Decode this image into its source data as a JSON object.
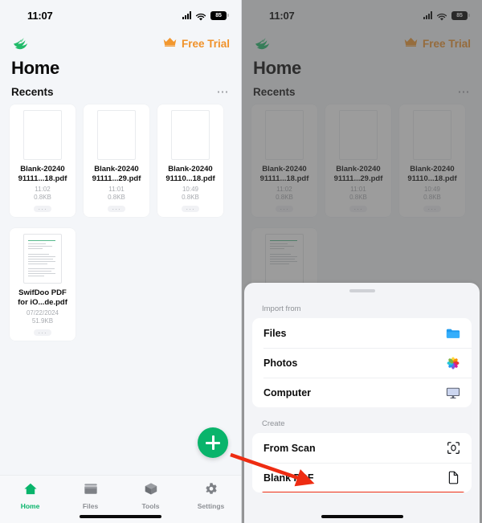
{
  "status_bar": {
    "time": "11:07",
    "signal_icon": "cellular-bars-icon",
    "wifi_icon": "wifi-icon",
    "battery_level": "85"
  },
  "header": {
    "logo_icon": "swifdoo-bird-logo",
    "crown_icon": "crown-icon",
    "trial_label": "Free Trial",
    "page_title": "Home"
  },
  "recents": {
    "section_title": "Recents",
    "more_icon": "ellipsis-icon",
    "items": [
      {
        "name": "Blank-2024091111...18.pdf",
        "name_line1": "Blank-20240",
        "name_line2": "91111...18.pdf",
        "time": "11:02",
        "size": "0.8KB",
        "more": "···"
      },
      {
        "name": "Blank-2024091111...29.pdf",
        "name_line1": "Blank-20240",
        "name_line2": "91111...29.pdf",
        "time": "11:01",
        "size": "0.8KB",
        "more": "···"
      },
      {
        "name": "Blank-2024091110...18.pdf",
        "name_line1": "Blank-20240",
        "name_line2": "91110...18.pdf",
        "time": "10:49",
        "size": "0.8KB",
        "more": "···"
      },
      {
        "name": "SwifDoo PDF for iO...de.pdf",
        "name_line1": "SwifDoo PDF",
        "name_line2": "for iO...de.pdf",
        "time": "07/22/2024",
        "size": "51.9KB",
        "more": "···"
      }
    ]
  },
  "fab": {
    "icon": "plus-icon",
    "label": ""
  },
  "tabbar": {
    "items": [
      {
        "label": "Home",
        "icon": "home-icon",
        "active": true
      },
      {
        "label": "Files",
        "icon": "folder-icon",
        "active": false
      },
      {
        "label": "Tools",
        "icon": "cube-icon",
        "active": false
      },
      {
        "label": "Settings",
        "icon": "gear-icon",
        "active": false
      }
    ]
  },
  "sheet": {
    "grabber_icon": "drag-handle-icon",
    "import_label": "Import from",
    "import_items": [
      {
        "label": "Files",
        "icon": "blue-folder-icon"
      },
      {
        "label": "Photos",
        "icon": "photos-flower-icon"
      },
      {
        "label": "Computer",
        "icon": "monitor-icon"
      }
    ],
    "create_label": "Create",
    "create_items": [
      {
        "label": "From Scan",
        "icon": "scan-icon"
      },
      {
        "label": "Blank PDF",
        "icon": "blank-document-icon"
      }
    ]
  },
  "annotation": {
    "arrow_icon": "red-arrow-icon",
    "highlight_icon": "red-highlight-box",
    "accent_red": "#ee2c12"
  },
  "colors": {
    "brand_green": "#09b46b",
    "trial_orange": "#f0922a",
    "panel_bg": "#f4f6f9",
    "card_bg": "#ffffff",
    "dim_overlay": "rgba(74,74,74,0.55)"
  }
}
